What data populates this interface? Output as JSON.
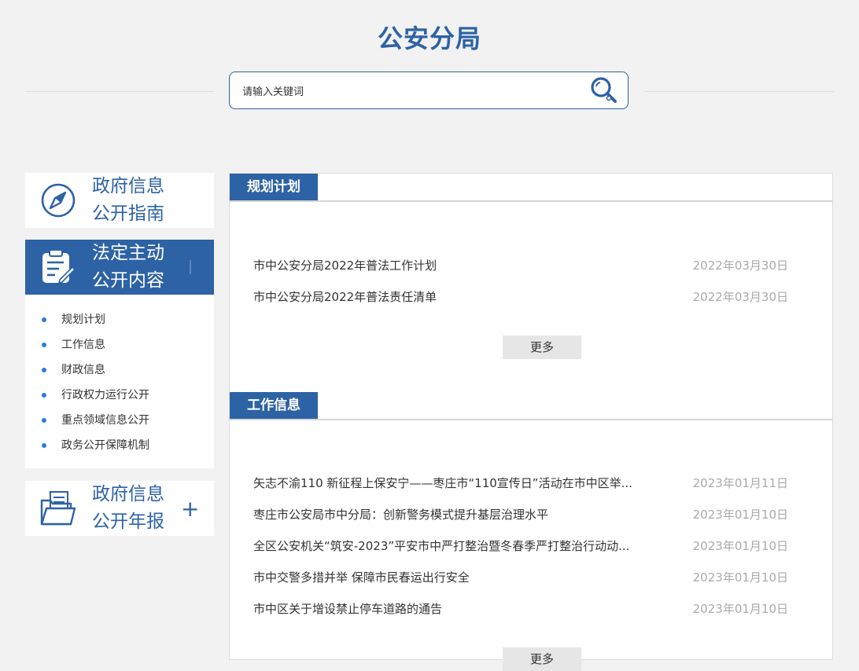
{
  "header": {
    "title": "公安分局"
  },
  "search": {
    "placeholder": "请输入关键词"
  },
  "sidebar": {
    "cards": [
      {
        "label_line1": "政府信息",
        "label_line2": "公开指南",
        "icon": "compass-icon"
      },
      {
        "label_line1": "法定主动",
        "label_line2": "公开内容",
        "icon": "clipboard-edit-icon"
      },
      {
        "label_line1": "政府信息",
        "label_line2": "公开年报",
        "icon": "folder-documents-icon",
        "expand": "+"
      }
    ],
    "sub_items": [
      "规划计划",
      "工作信息",
      "财政信息",
      "行政权力运行公开",
      "重点领域信息公开",
      "政务公开保障机制"
    ]
  },
  "sections": [
    {
      "title": "规划计划",
      "items": [
        {
          "title": "市中公安分局2022年普法工作计划",
          "date": "2022年03月30日"
        },
        {
          "title": "市中公安分局2022年普法责任清单",
          "date": "2022年03月30日"
        }
      ],
      "more_label": "更多"
    },
    {
      "title": "工作信息",
      "items": [
        {
          "title": "矢志不渝110 新征程上保安宁——枣庄市“110宣传日”活动在市中区举...",
          "date": "2023年01月11日"
        },
        {
          "title": "枣庄市公安局市中分局：创新警务模式提升基层治理水平",
          "date": "2023年01月10日"
        },
        {
          "title": "全区公安机关“筑安-2023”平安市中严打整治暨冬春季严打整治行动动...",
          "date": "2023年01月10日"
        },
        {
          "title": "市中交警多措并举 保障市民春运出行安全",
          "date": "2023年01月10日"
        },
        {
          "title": "市中区关于增设禁止停车道路的通告",
          "date": "2023年01月10日"
        }
      ],
      "more_label": "更多"
    }
  ],
  "colors": {
    "brand": "#2d62a5",
    "bullet": "#2d7bd6",
    "date": "#aaaaaa",
    "background": "#f2f2f2"
  }
}
